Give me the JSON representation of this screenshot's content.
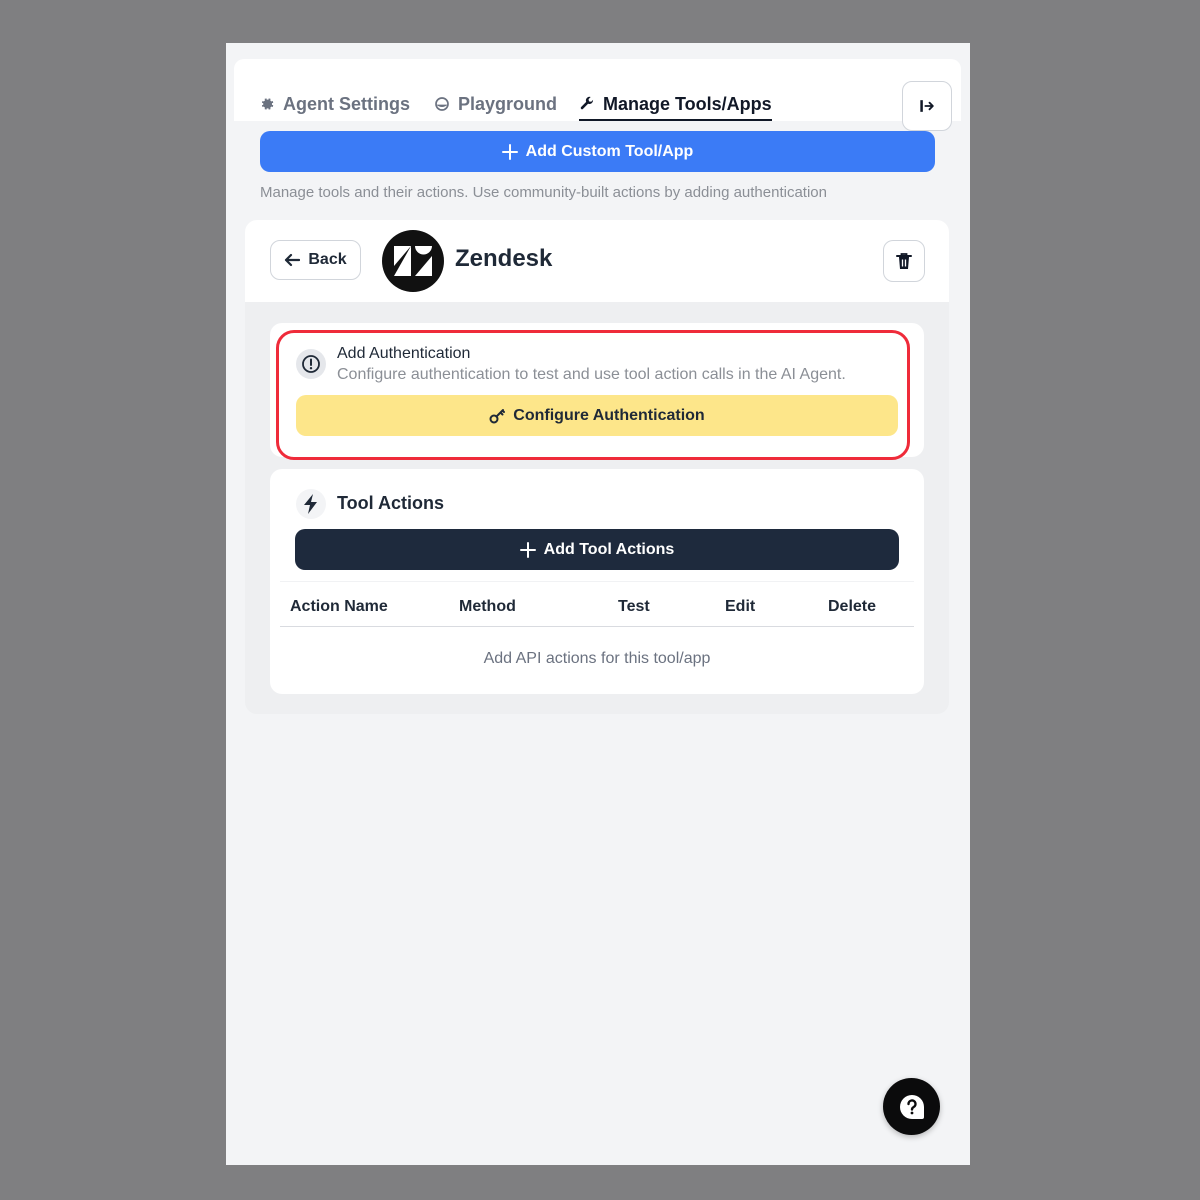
{
  "nav": {
    "tabs": [
      {
        "label": "Agent Settings",
        "icon": "gear-icon"
      },
      {
        "label": "Playground",
        "icon": "playground-icon"
      },
      {
        "label": "Manage Tools/Apps",
        "icon": "wrench-icon",
        "active": true
      }
    ],
    "exit_icon": "exit-icon"
  },
  "toolbar": {
    "add_custom_label": "Add Custom Tool/App",
    "helper_text": "Manage tools and their actions. Use community-built actions by adding authentication"
  },
  "tool": {
    "back_label": "Back",
    "name": "Zendesk",
    "logo_icon": "zendesk-logo"
  },
  "auth": {
    "title": "Add Authentication",
    "description": "Configure authentication to test and use tool action calls in the AI Agent.",
    "button_label": "Configure Authentication"
  },
  "actions": {
    "title": "Tool Actions",
    "add_label": "Add Tool Actions",
    "columns": [
      "Action Name",
      "Method",
      "Test",
      "Edit",
      "Delete"
    ],
    "empty_text": "Add API actions for this tool/app"
  },
  "colors": {
    "primary": "#3b7bf6",
    "warning": "#fde68a",
    "dark": "#1e2a3d",
    "highlight": "#ef2b3a"
  }
}
